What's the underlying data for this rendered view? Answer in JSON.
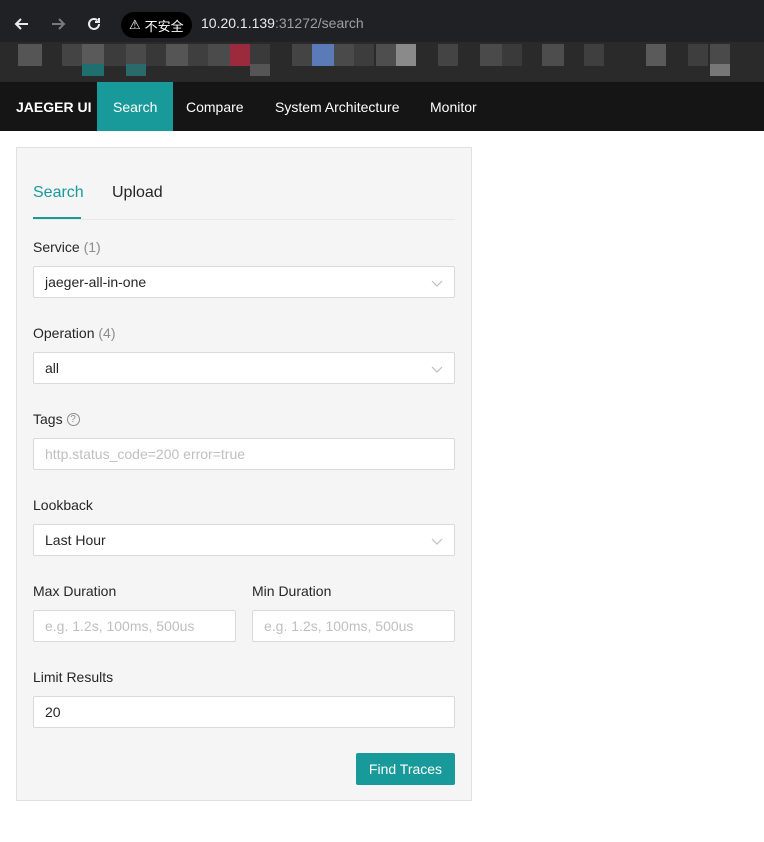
{
  "browser": {
    "security_warning": "不安全",
    "url_host": "10.20.1.139",
    "url_rest": ":31272/search"
  },
  "nav": {
    "brand": "JAEGER UI",
    "items": [
      "Search",
      "Compare",
      "System Architecture",
      "Monitor"
    ],
    "active": "Search"
  },
  "search_panel": {
    "tabs": [
      "Search",
      "Upload"
    ],
    "active_tab": "Search",
    "service": {
      "label": "Service",
      "count": "(1)",
      "value": "jaeger-all-in-one"
    },
    "operation": {
      "label": "Operation",
      "count": "(4)",
      "value": "all"
    },
    "tags": {
      "label": "Tags",
      "placeholder": "http.status_code=200 error=true"
    },
    "lookback": {
      "label": "Lookback",
      "value": "Last Hour"
    },
    "max_duration": {
      "label": "Max Duration",
      "placeholder": "e.g. 1.2s, 100ms, 500us"
    },
    "min_duration": {
      "label": "Min Duration",
      "placeholder": "e.g. 1.2s, 100ms, 500us"
    },
    "limit": {
      "label": "Limit Results",
      "value": "20"
    },
    "submit_label": "Find Traces"
  },
  "colors": {
    "accent": "#199a9a",
    "nav_bg": "#151515",
    "panel_bg": "#f5f5f5"
  }
}
